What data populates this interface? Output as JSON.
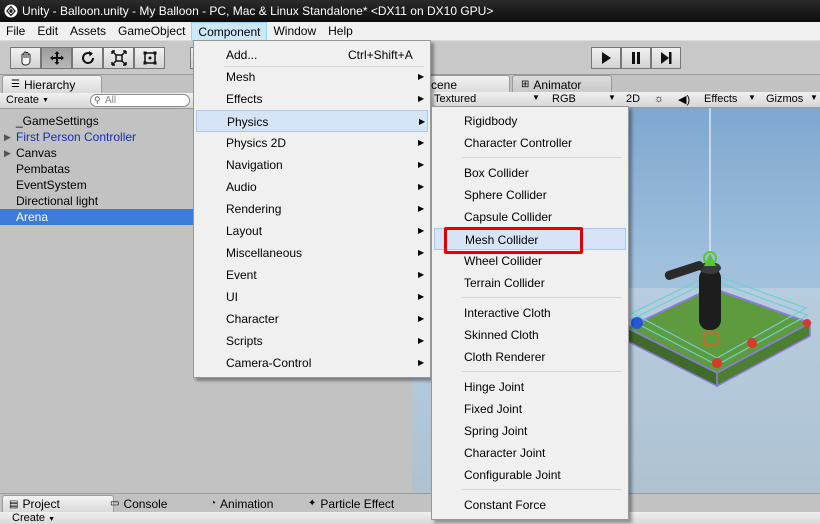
{
  "window": {
    "title": "Unity - Balloon.unity - My Balloon - PC, Mac & Linux Standalone* <DX11 on DX10 GPU>"
  },
  "menubar": [
    "File",
    "Edit",
    "Assets",
    "GameObject",
    "Component",
    "Window",
    "Help"
  ],
  "menubar_active": "Component",
  "toolbar": {
    "transform_tools": [
      "hand-icon",
      "move-icon",
      "rotate-icon",
      "scale-icon",
      "rect-icon"
    ],
    "playback": [
      "play-icon",
      "pause-icon",
      "step-icon"
    ]
  },
  "hierarchy": {
    "tab": "Hierarchy",
    "create": "Create",
    "search_placeholder": "All",
    "items": [
      {
        "label": "_GameSettings",
        "fold": false,
        "prefab": false,
        "selected": false
      },
      {
        "label": "First Person Controller",
        "fold": true,
        "prefab": true,
        "selected": false
      },
      {
        "label": "Canvas",
        "fold": true,
        "prefab": false,
        "selected": false
      },
      {
        "label": "Pembatas",
        "fold": false,
        "prefab": false,
        "selected": false
      },
      {
        "label": "EventSystem",
        "fold": false,
        "prefab": false,
        "selected": false
      },
      {
        "label": "Directional light",
        "fold": false,
        "prefab": false,
        "selected": false
      },
      {
        "label": "Arena",
        "fold": false,
        "prefab": false,
        "selected": true
      }
    ]
  },
  "scene": {
    "tabs": [
      "Scene",
      "Animator"
    ],
    "shading": "Textured",
    "render_mode": "RGB",
    "toggle_2d": "2D",
    "effects": "Effects",
    "gizmos": "Gizmos"
  },
  "bottom": {
    "tabs": [
      "Project",
      "Console",
      "Animation",
      "Particle Effect"
    ],
    "create": "Create"
  },
  "component_menu": [
    {
      "label": "Add...",
      "shortcut": "Ctrl+Shift+A",
      "submenu": false
    },
    {
      "label": "Mesh",
      "submenu": true
    },
    {
      "label": "Effects",
      "submenu": true
    },
    {
      "label": "Physics",
      "submenu": true,
      "highlighted": true
    },
    {
      "label": "Physics 2D",
      "submenu": true
    },
    {
      "label": "Navigation",
      "submenu": true
    },
    {
      "label": "Audio",
      "submenu": true
    },
    {
      "label": "Rendering",
      "submenu": true
    },
    {
      "label": "Layout",
      "submenu": true
    },
    {
      "label": "Miscellaneous",
      "submenu": true
    },
    {
      "label": "Event",
      "submenu": true
    },
    {
      "label": "UI",
      "submenu": true
    },
    {
      "label": "Character",
      "submenu": true
    },
    {
      "label": "Scripts",
      "submenu": true
    },
    {
      "label": "Camera-Control",
      "submenu": true
    }
  ],
  "physics_menu": {
    "groups": [
      [
        "Rigidbody",
        "Character Controller"
      ],
      [
        "Box Collider",
        "Sphere Collider",
        "Capsule Collider",
        "Mesh Collider",
        "Wheel Collider",
        "Terrain Collider"
      ],
      [
        "Interactive Cloth",
        "Skinned Cloth",
        "Cloth Renderer"
      ],
      [
        "Hinge Joint",
        "Fixed Joint",
        "Spring Joint",
        "Character Joint",
        "Configurable Joint"
      ],
      [
        "Constant Force"
      ]
    ],
    "highlighted": "Mesh Collider"
  },
  "colors": {
    "selection": "#3d7cd6",
    "prefab_text": "#1a2eaa",
    "annotation_box": "#e00000",
    "menu_highlight": "#d5e5f7"
  }
}
